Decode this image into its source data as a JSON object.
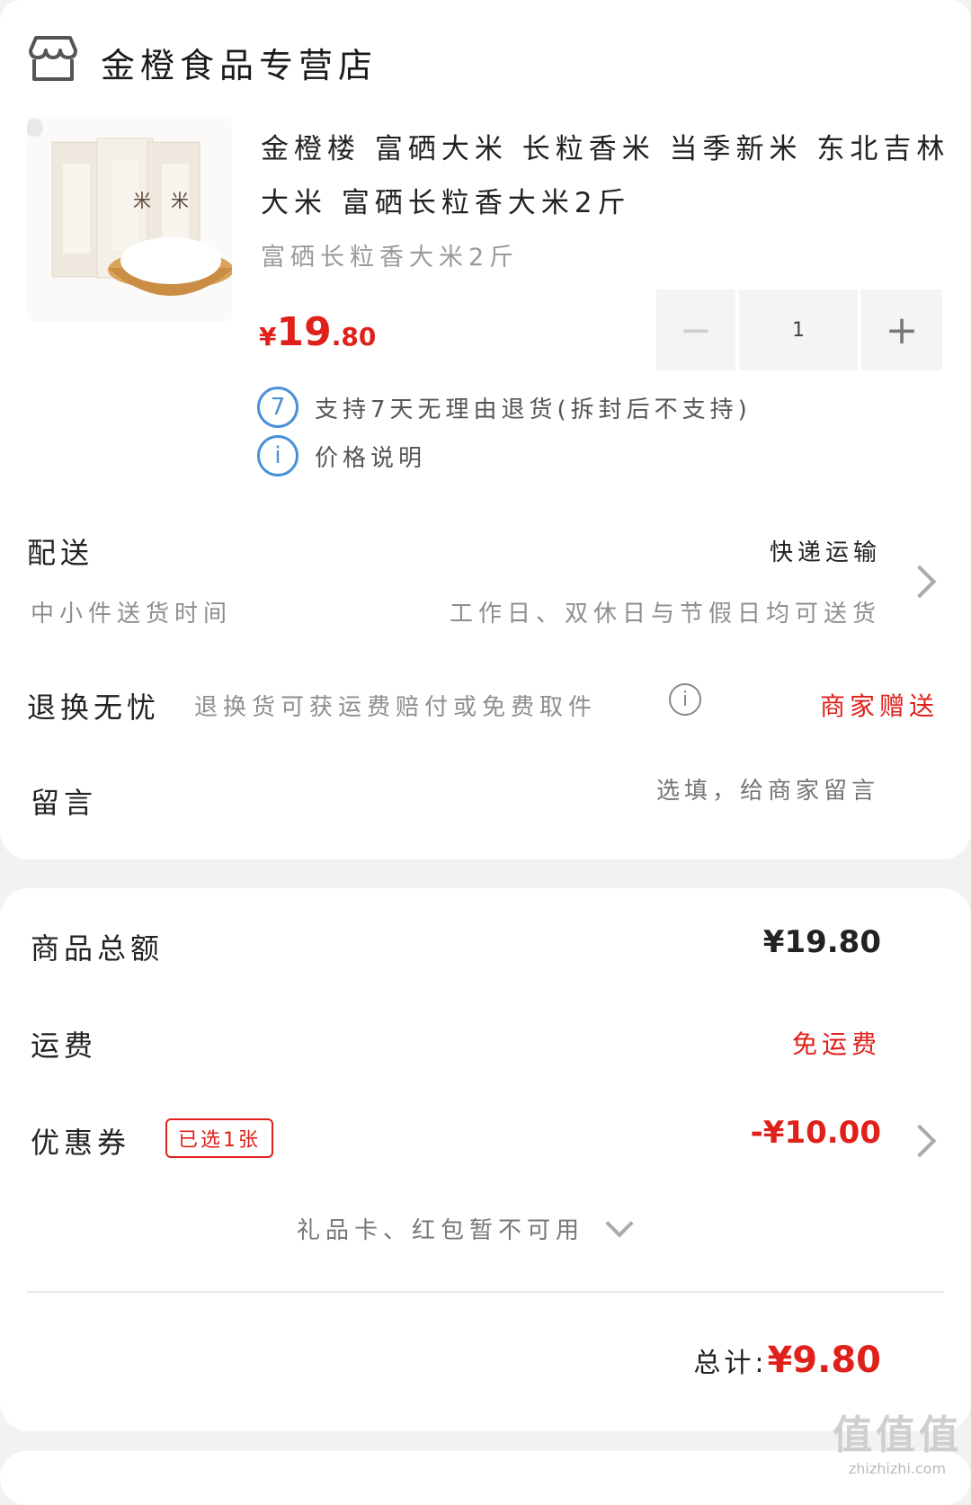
{
  "store": {
    "name": "金橙食品专营店",
    "icon": "store-icon"
  },
  "product": {
    "title": "金橙楼 富硒大米 长粒香米 当季新米 东北吉林大米 富硒长粒香大米2斤",
    "spec": "富硒长粒香大米2斤",
    "price": {
      "currency": "¥",
      "integer": "19",
      "decimal": ".80"
    },
    "quantity": "1",
    "minus": "−",
    "plus": "+"
  },
  "services": [
    {
      "icon_text": "7",
      "icon": "seven-day-return-icon",
      "text": "支持7天无理由退货(拆封后不支持)"
    },
    {
      "icon_text": "i",
      "icon": "info-icon",
      "text": "价格说明"
    }
  ],
  "delivery": {
    "label": "配送",
    "method": "快递运输",
    "time_label": "中小件送货时间",
    "time_value": "工作日、双休日与节假日均可送货"
  },
  "return_service": {
    "label": "退换无忧",
    "desc": "退换货可获运费赔付或免费取件",
    "tag": "商家赠送"
  },
  "message": {
    "label": "留言",
    "placeholder": "选填，给商家留言"
  },
  "summary": {
    "goods_total_label": "商品总额",
    "goods_total_value": "¥19.80",
    "shipping_label": "运费",
    "shipping_value": "免运费",
    "coupon_label": "优惠券",
    "coupon_badge": "已选1张",
    "coupon_value": "-¥10.00",
    "giftcard_text": "礼品卡、红包暂不可用",
    "total_label": "总计:",
    "total_value": "¥9.80"
  },
  "watermark": {
    "big": "值值值",
    "small": "zhizhizhi.com"
  },
  "colors": {
    "accent": "#e0201a",
    "info_blue": "#4a90d9"
  }
}
